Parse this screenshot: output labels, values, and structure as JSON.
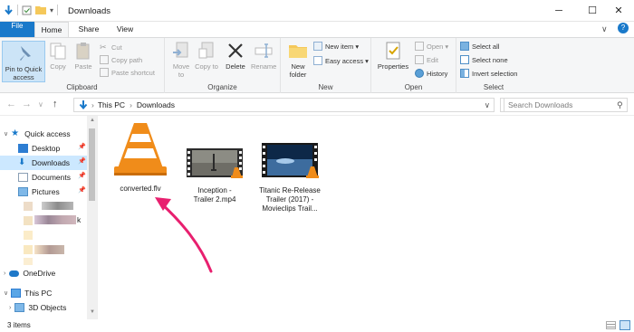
{
  "window": {
    "title": "Downloads",
    "controls": {
      "minimize": "─",
      "maximize": "☐",
      "close": "✕"
    }
  },
  "ribbon_tabs": {
    "file": "File",
    "home": "Home",
    "share": "Share",
    "view": "View"
  },
  "ribbon": {
    "clipboard": {
      "label": "Clipboard",
      "pin": "Pin to Quick access",
      "copy": "Copy",
      "paste": "Paste",
      "cut": "Cut",
      "copy_path": "Copy path",
      "paste_shortcut": "Paste shortcut"
    },
    "organize": {
      "label": "Organize",
      "move_to": "Move to",
      "copy_to": "Copy to",
      "delete": "Delete",
      "rename": "Rename"
    },
    "new": {
      "label": "New",
      "new_folder": "New folder",
      "new_item": "New item ▾",
      "easy_access": "Easy access ▾"
    },
    "open": {
      "label": "Open",
      "properties": "Properties",
      "open": "Open ▾",
      "edit": "Edit",
      "history": "History"
    },
    "select": {
      "label": "Select",
      "select_all": "Select all",
      "select_none": "Select none",
      "invert": "Invert selection"
    }
  },
  "address": {
    "this_pc": "This PC",
    "downloads": "Downloads",
    "search_placeholder": "Search Downloads"
  },
  "nav": {
    "quick_access": "Quick access",
    "desktop": "Desktop",
    "downloads": "Downloads",
    "documents": "Documents",
    "pictures": "Pictures",
    "onedrive": "OneDrive",
    "this_pc": "This PC",
    "objects3d": "3D Objects",
    "partial": "k"
  },
  "files": [
    {
      "name": "converted.flv"
    },
    {
      "name": "Inception - Trailer 2.mp4"
    },
    {
      "name": "Titanic Re-Release Trailer (2017) - Movieclips Trail..."
    }
  ],
  "status": {
    "items": "3 items"
  },
  "colors": {
    "accent": "#1979ca",
    "selected": "#cce8ff",
    "annotation_arrow": "#e8206f"
  }
}
